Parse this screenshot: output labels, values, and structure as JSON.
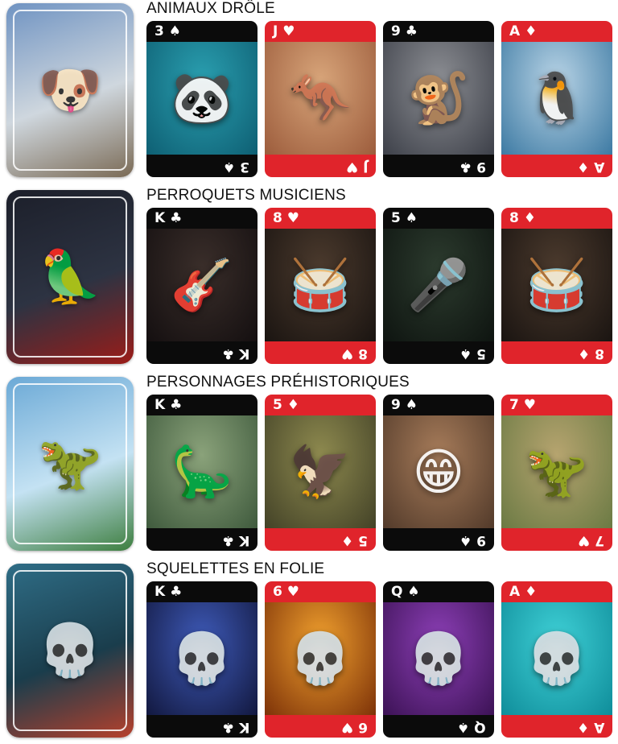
{
  "rows": [
    {
      "title": "ANIMAUX DRÔLE",
      "back": {
        "icon": "aviator-dog-icon",
        "glyph": "🐶",
        "colors": [
          "#6f93c2",
          "#cfd7de",
          "#7a6a55"
        ]
      },
      "cards": [
        {
          "rank": "3 ♠",
          "rank_inverted": "3 ♠",
          "color": "black",
          "subject": "panda-diver",
          "glyph": "🐼",
          "bg": [
            "#2a9fb0",
            "#0e5f73"
          ]
        },
        {
          "rank": "J ♥",
          "rank_inverted": "J ♥",
          "color": "red",
          "subject": "boxing-kangaroo",
          "glyph": "🦘",
          "bg": [
            "#d8a57a",
            "#9c5c3c"
          ]
        },
        {
          "rank": "9 ♣",
          "rank_inverted": "9 ♣",
          "color": "black",
          "subject": "skating-monkey",
          "glyph": "🐒",
          "bg": [
            "#8d8f94",
            "#3d4049"
          ]
        },
        {
          "rank": "A ♦",
          "rank_inverted": "A ♦",
          "color": "red",
          "subject": "surfing-penguin",
          "glyph": "🐧",
          "bg": [
            "#b9d4e6",
            "#3d7aa3"
          ]
        }
      ]
    },
    {
      "title": "PERROQUETS MUSICIENS",
      "back": {
        "icon": "parrot-guitarist-icon",
        "glyph": "🦜",
        "colors": [
          "#1c1f2a",
          "#2d3342",
          "#9b1c18"
        ]
      },
      "cards": [
        {
          "rank": "K ♣",
          "rank_inverted": "K ♣",
          "color": "black",
          "subject": "parrot-guitarist",
          "glyph": "🎸",
          "bg": [
            "#3a2e2a",
            "#140f10"
          ]
        },
        {
          "rank": "8 ♥",
          "rank_inverted": "8 ♥",
          "color": "red",
          "subject": "parrot-drummer",
          "glyph": "🥁",
          "bg": [
            "#4b3a2d",
            "#1a1411"
          ]
        },
        {
          "rank": "5 ♠",
          "rank_inverted": "5 ♠",
          "color": "black",
          "subject": "parrot-singer",
          "glyph": "🎤",
          "bg": [
            "#2c3b2e",
            "#0e1410"
          ]
        },
        {
          "rank": "8 ♦",
          "rank_inverted": "8 ♦",
          "color": "red",
          "subject": "parrot-drummer",
          "glyph": "🥁",
          "bg": [
            "#4b3a2d",
            "#1a1411"
          ]
        }
      ]
    },
    {
      "title": "PERSONNAGES PRÉHISTORIQUES",
      "back": {
        "icon": "dinosaurs-icon",
        "glyph": "🦖",
        "colors": [
          "#6ba9d6",
          "#c4e2f3",
          "#3d7e3f"
        ]
      },
      "cards": [
        {
          "rank": "K ♣",
          "rank_inverted": "K ♣",
          "color": "black",
          "subject": "dino-king",
          "glyph": "🦕",
          "bg": [
            "#8aa27a",
            "#3f5a3d"
          ]
        },
        {
          "rank": "5 ♦",
          "rank_inverted": "5 ♦",
          "color": "red",
          "subject": "pterodactyl",
          "glyph": "🦅",
          "bg": [
            "#8e8a4f",
            "#434227"
          ]
        },
        {
          "rank": "9 ♠",
          "rank_inverted": "9 ♠",
          "color": "black",
          "subject": "cavemen-trio",
          "glyph": "😁",
          "bg": [
            "#a77c5a",
            "#523a2a"
          ]
        },
        {
          "rank": "7 ♥",
          "rank_inverted": "7 ♥",
          "color": "red",
          "subject": "green-dinosaur",
          "glyph": "🦖",
          "bg": [
            "#b6a46f",
            "#6b7a44"
          ]
        }
      ]
    },
    {
      "title": "SQUELETTES EN FOLIE",
      "back": {
        "icon": "skeleton-family-icon",
        "glyph": "💀",
        "colors": [
          "#2f6d86",
          "#1a3d4c",
          "#b6402c"
        ]
      },
      "cards": [
        {
          "rank": "K ♣",
          "rank_inverted": "K ♣",
          "color": "black",
          "subject": "skeleton-king",
          "glyph": "💀",
          "bg": [
            "#3e5ab8",
            "#12183f"
          ]
        },
        {
          "rank": "6 ♥",
          "rank_inverted": "6 ♥",
          "color": "red",
          "subject": "skeleton-chef",
          "glyph": "💀",
          "bg": [
            "#f0a02e",
            "#7d3208"
          ]
        },
        {
          "rank": "Q ♠",
          "rank_inverted": "Q ♠",
          "color": "black",
          "subject": "skeleton-queen",
          "glyph": "💀",
          "bg": [
            "#8c3fb6",
            "#3c1255"
          ]
        },
        {
          "rank": "A ♦",
          "rank_inverted": "A ♦",
          "color": "red",
          "subject": "skeleton-liberty",
          "glyph": "💀",
          "bg": [
            "#3fd0d6",
            "#0f8d9a"
          ]
        }
      ]
    }
  ]
}
